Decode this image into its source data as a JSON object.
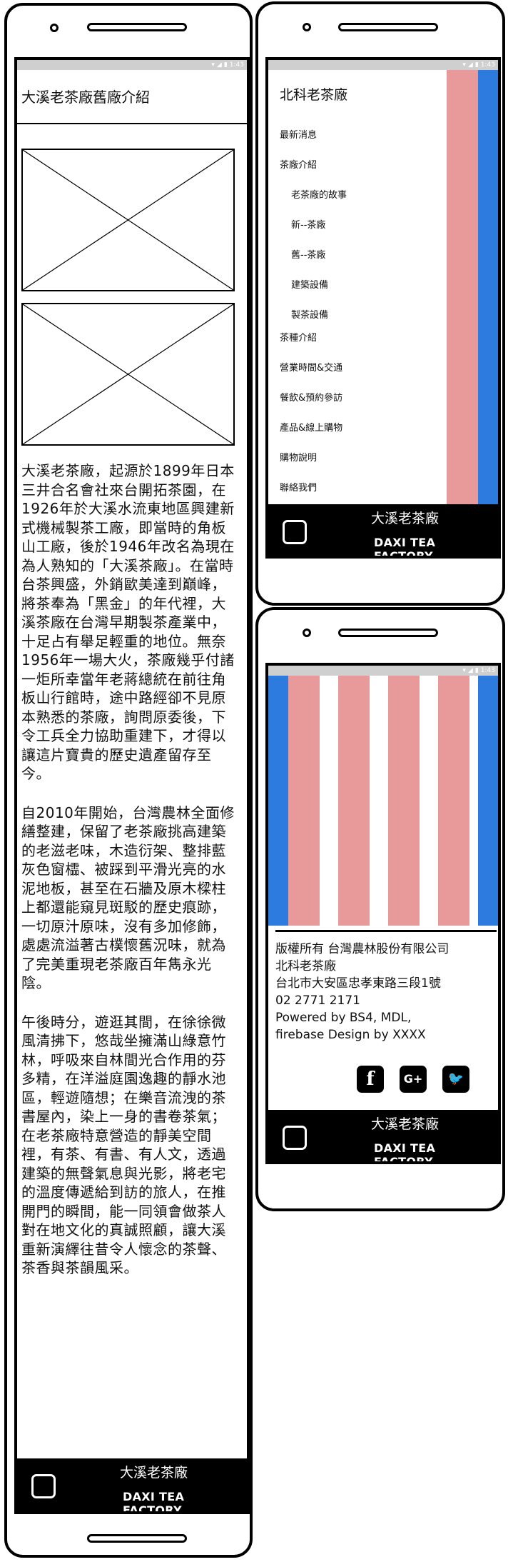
{
  "colors": {
    "pink": "#e89a9a",
    "blue": "#2e7be0",
    "black": "#000000",
    "statusbar": "#cfcfcf"
  },
  "status_bar": {
    "time": "1:43",
    "wifi_icon": "wifi-icon",
    "signal_icon": "signal-icon",
    "battery_icon": "battery-icon"
  },
  "screen1": {
    "title": "大溪老茶廠舊廠介紹",
    "image_placeholders": [
      "image-placeholder",
      "image-placeholder"
    ],
    "paragraphs": [
      "大溪老茶廠，起源於1899年日本三井合名會社來台開拓茶園，在1926年於大溪水流東地區興建新式機械製茶工廠，即當時的角板山工廠，後於1946年改名為現在為人熟知的「大溪茶廠」。在當時台茶興盛，外銷歐美達到巔峰，將茶奉為「黑金」的年代裡，大溪茶廠在台灣早期製茶產業中，十足占有舉足輕重的地位。無奈1956年一場大火，茶廠幾乎付諸一炬所幸當年老蔣總統在前往角板山行館時，途中路經卻不見原本熟悉的茶廠，詢問原委後，下令工兵全力協助重建下，才得以讓這片寶貴的歷史遺產留存至今。",
      "自2010年開始，台灣農林全面修繕整建，保留了老茶廠挑高建築的老滋老味，木造衍架、整排藍灰色窗櫺、被踩到平滑光亮的水泥地板，甚至在石牆及原木樑柱上都還能窺見斑駁的歷史痕跡，一切原汁原味，沒有多加修飾，處處流溢著古樸懷舊況味，就為了完美重現老茶廠百年雋永光陰。",
      "午後時分，遊逛其間，在徐徐微風清拂下，悠哉坐擁滿山綠意竹林，呼吸來自林間光合作用的芬多精，在洋溢庭園逸趣的靜水池區，輕遊隨想；在樂音流洩的茶書屋內，染上一身的書卷茶氣；在老茶廠特意營造的靜美空間裡，有茶、有書、有人文，透過建築的無聲氣息與光影，將老宅的溫度傳遞給到訪的旅人，在推開門的瞬間，能一同領會做茶人對在地文化的真誠照顧，讓大溪重新演繹往昔令人懷念的茶聲、茶香與茶韻風采。"
    ],
    "footer": {
      "brand_zh": "大溪老茶廠",
      "brand_en": "DAXI TEA FACTORY",
      "home_icon": "home-icon"
    }
  },
  "screen2": {
    "drawer_title": "北科老茶廠",
    "menu": [
      {
        "label": "最新消息",
        "indent": false
      },
      {
        "label": "茶廠介紹",
        "indent": false
      },
      {
        "label": "老茶廠的故事",
        "indent": true
      },
      {
        "label": "新--茶廠",
        "indent": true
      },
      {
        "label": "舊--茶廠",
        "indent": true
      },
      {
        "label": "建築設備",
        "indent": true
      },
      {
        "label": "製茶設備",
        "indent": true
      },
      {
        "label": "茶種介紹",
        "indent": false
      },
      {
        "label": "營業時間&交通",
        "indent": false
      },
      {
        "label": "餐飲&預約參訪",
        "indent": false
      },
      {
        "label": "產品&線上購物",
        "indent": false
      },
      {
        "label": "購物說明",
        "indent": false
      },
      {
        "label": "聯絡我們",
        "indent": false
      }
    ],
    "footer": {
      "brand_zh": "大溪老茶廠",
      "brand_en": "DAXI TEA FACTORY",
      "home_icon": "home-icon"
    }
  },
  "screen3": {
    "info_lines": [
      "版權所有 台灣農林股份有限公司",
      "北科老茶廠",
      "台北市大安區忠孝東路三段1號",
      "02 2771 2171",
      "Powered by BS4, MDL,",
      "firebase Design by XXXX"
    ],
    "social": [
      {
        "icon": "facebook-icon",
        "glyph": "f"
      },
      {
        "icon": "google-plus-icon",
        "glyph": "G+"
      },
      {
        "icon": "twitter-icon",
        "glyph": "🐦"
      }
    ],
    "footer": {
      "brand_zh": "大溪老茶廠",
      "brand_en": "DAXI TEA FACTORY",
      "home_icon": "home-icon"
    }
  }
}
